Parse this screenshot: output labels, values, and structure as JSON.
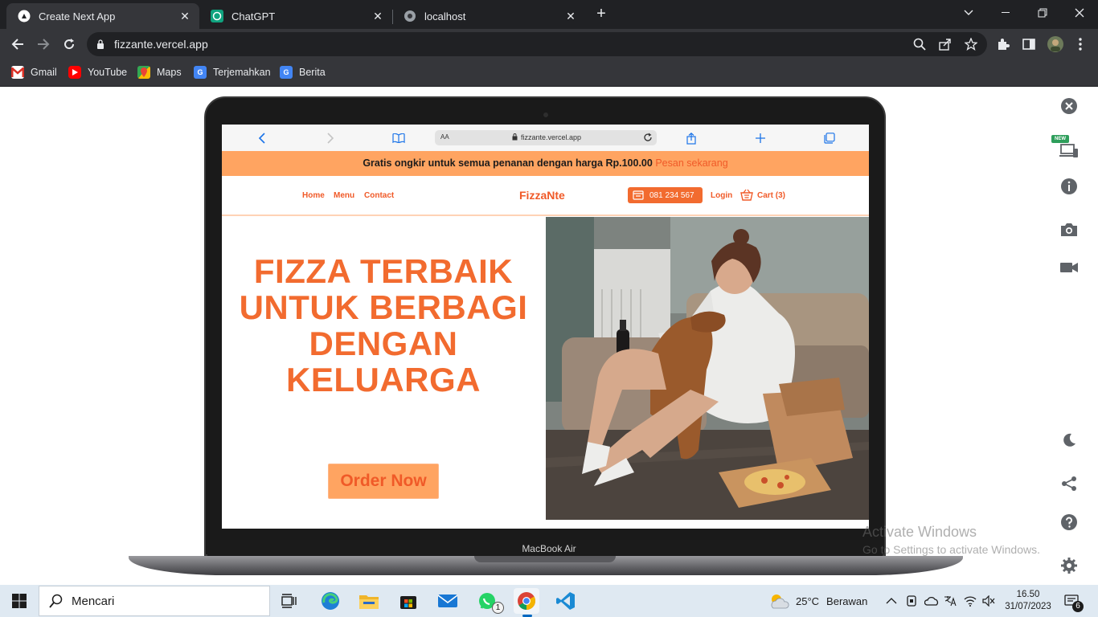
{
  "browser": {
    "tabs": [
      {
        "title": "Create Next App",
        "active": true
      },
      {
        "title": "ChatGPT",
        "active": false
      },
      {
        "title": "localhost",
        "active": false
      }
    ],
    "url": "fizzante.vercel.app",
    "bookmarks": [
      "Gmail",
      "YouTube",
      "Maps",
      "Terjemahkan",
      "Berita"
    ]
  },
  "mockup": {
    "device_label": "MacBook Air",
    "safari": {
      "text_size": "AA",
      "url": "fizzante.vercel.app"
    }
  },
  "site": {
    "promo_text": "Gratis ongkir untuk semua penanan dengan harga Rp.100.00",
    "promo_cta": "Pesan sekarang",
    "nav": {
      "home": "Home",
      "menu": "Menu",
      "contact": "Contact"
    },
    "brand": "FizzaNte",
    "phone": "081 234 567",
    "login": "Login",
    "cart": "Cart (3)",
    "hero_title": "FIZZA TERBAIK UNTUK BERBAGI DENGAN KELUARGA",
    "order_button": "Order Now"
  },
  "sidebar": {
    "new_badge": "NEW"
  },
  "watermark": {
    "heading": "Activate Windows",
    "subtext": "Go to Settings to activate Windows."
  },
  "taskbar": {
    "search_placeholder": "Mencari",
    "whatsapp_badge": "1",
    "weather_temp": "25°C",
    "weather_desc": "Berawan",
    "time": "16.50",
    "date": "31/07/2023",
    "notification_count": "6"
  },
  "colors": {
    "accent_orange": "#f26b2f",
    "promo_bg": "#ffa461",
    "chrome_dark": "#202124"
  }
}
